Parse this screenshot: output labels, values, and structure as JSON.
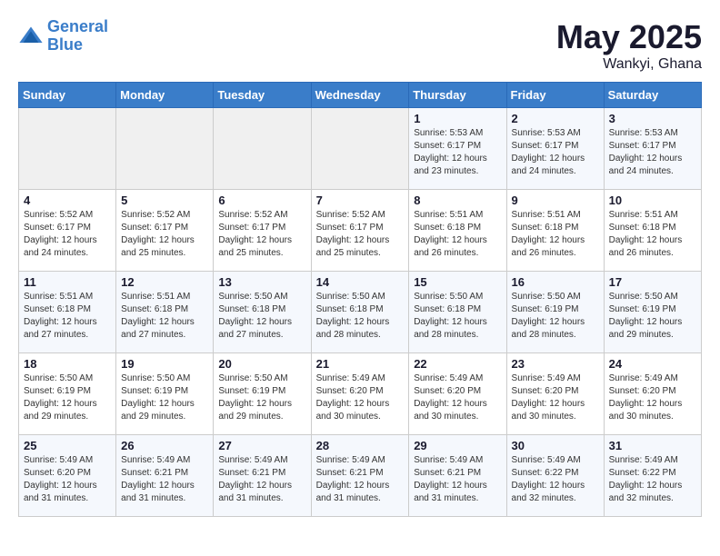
{
  "header": {
    "logo_line1": "General",
    "logo_line2": "Blue",
    "title": "May 2025",
    "subtitle": "Wankyi, Ghana"
  },
  "weekdays": [
    "Sunday",
    "Monday",
    "Tuesday",
    "Wednesday",
    "Thursday",
    "Friday",
    "Saturday"
  ],
  "weeks": [
    [
      {
        "day": "",
        "info": ""
      },
      {
        "day": "",
        "info": ""
      },
      {
        "day": "",
        "info": ""
      },
      {
        "day": "",
        "info": ""
      },
      {
        "day": "1",
        "info": "Sunrise: 5:53 AM\nSunset: 6:17 PM\nDaylight: 12 hours\nand 23 minutes."
      },
      {
        "day": "2",
        "info": "Sunrise: 5:53 AM\nSunset: 6:17 PM\nDaylight: 12 hours\nand 24 minutes."
      },
      {
        "day": "3",
        "info": "Sunrise: 5:53 AM\nSunset: 6:17 PM\nDaylight: 12 hours\nand 24 minutes."
      }
    ],
    [
      {
        "day": "4",
        "info": "Sunrise: 5:52 AM\nSunset: 6:17 PM\nDaylight: 12 hours\nand 24 minutes."
      },
      {
        "day": "5",
        "info": "Sunrise: 5:52 AM\nSunset: 6:17 PM\nDaylight: 12 hours\nand 25 minutes."
      },
      {
        "day": "6",
        "info": "Sunrise: 5:52 AM\nSunset: 6:17 PM\nDaylight: 12 hours\nand 25 minutes."
      },
      {
        "day": "7",
        "info": "Sunrise: 5:52 AM\nSunset: 6:17 PM\nDaylight: 12 hours\nand 25 minutes."
      },
      {
        "day": "8",
        "info": "Sunrise: 5:51 AM\nSunset: 6:18 PM\nDaylight: 12 hours\nand 26 minutes."
      },
      {
        "day": "9",
        "info": "Sunrise: 5:51 AM\nSunset: 6:18 PM\nDaylight: 12 hours\nand 26 minutes."
      },
      {
        "day": "10",
        "info": "Sunrise: 5:51 AM\nSunset: 6:18 PM\nDaylight: 12 hours\nand 26 minutes."
      }
    ],
    [
      {
        "day": "11",
        "info": "Sunrise: 5:51 AM\nSunset: 6:18 PM\nDaylight: 12 hours\nand 27 minutes."
      },
      {
        "day": "12",
        "info": "Sunrise: 5:51 AM\nSunset: 6:18 PM\nDaylight: 12 hours\nand 27 minutes."
      },
      {
        "day": "13",
        "info": "Sunrise: 5:50 AM\nSunset: 6:18 PM\nDaylight: 12 hours\nand 27 minutes."
      },
      {
        "day": "14",
        "info": "Sunrise: 5:50 AM\nSunset: 6:18 PM\nDaylight: 12 hours\nand 28 minutes."
      },
      {
        "day": "15",
        "info": "Sunrise: 5:50 AM\nSunset: 6:18 PM\nDaylight: 12 hours\nand 28 minutes."
      },
      {
        "day": "16",
        "info": "Sunrise: 5:50 AM\nSunset: 6:19 PM\nDaylight: 12 hours\nand 28 minutes."
      },
      {
        "day": "17",
        "info": "Sunrise: 5:50 AM\nSunset: 6:19 PM\nDaylight: 12 hours\nand 29 minutes."
      }
    ],
    [
      {
        "day": "18",
        "info": "Sunrise: 5:50 AM\nSunset: 6:19 PM\nDaylight: 12 hours\nand 29 minutes."
      },
      {
        "day": "19",
        "info": "Sunrise: 5:50 AM\nSunset: 6:19 PM\nDaylight: 12 hours\nand 29 minutes."
      },
      {
        "day": "20",
        "info": "Sunrise: 5:50 AM\nSunset: 6:19 PM\nDaylight: 12 hours\nand 29 minutes."
      },
      {
        "day": "21",
        "info": "Sunrise: 5:49 AM\nSunset: 6:20 PM\nDaylight: 12 hours\nand 30 minutes."
      },
      {
        "day": "22",
        "info": "Sunrise: 5:49 AM\nSunset: 6:20 PM\nDaylight: 12 hours\nand 30 minutes."
      },
      {
        "day": "23",
        "info": "Sunrise: 5:49 AM\nSunset: 6:20 PM\nDaylight: 12 hours\nand 30 minutes."
      },
      {
        "day": "24",
        "info": "Sunrise: 5:49 AM\nSunset: 6:20 PM\nDaylight: 12 hours\nand 30 minutes."
      }
    ],
    [
      {
        "day": "25",
        "info": "Sunrise: 5:49 AM\nSunset: 6:20 PM\nDaylight: 12 hours\nand 31 minutes."
      },
      {
        "day": "26",
        "info": "Sunrise: 5:49 AM\nSunset: 6:21 PM\nDaylight: 12 hours\nand 31 minutes."
      },
      {
        "day": "27",
        "info": "Sunrise: 5:49 AM\nSunset: 6:21 PM\nDaylight: 12 hours\nand 31 minutes."
      },
      {
        "day": "28",
        "info": "Sunrise: 5:49 AM\nSunset: 6:21 PM\nDaylight: 12 hours\nand 31 minutes."
      },
      {
        "day": "29",
        "info": "Sunrise: 5:49 AM\nSunset: 6:21 PM\nDaylight: 12 hours\nand 31 minutes."
      },
      {
        "day": "30",
        "info": "Sunrise: 5:49 AM\nSunset: 6:22 PM\nDaylight: 12 hours\nand 32 minutes."
      },
      {
        "day": "31",
        "info": "Sunrise: 5:49 AM\nSunset: 6:22 PM\nDaylight: 12 hours\nand 32 minutes."
      }
    ]
  ]
}
